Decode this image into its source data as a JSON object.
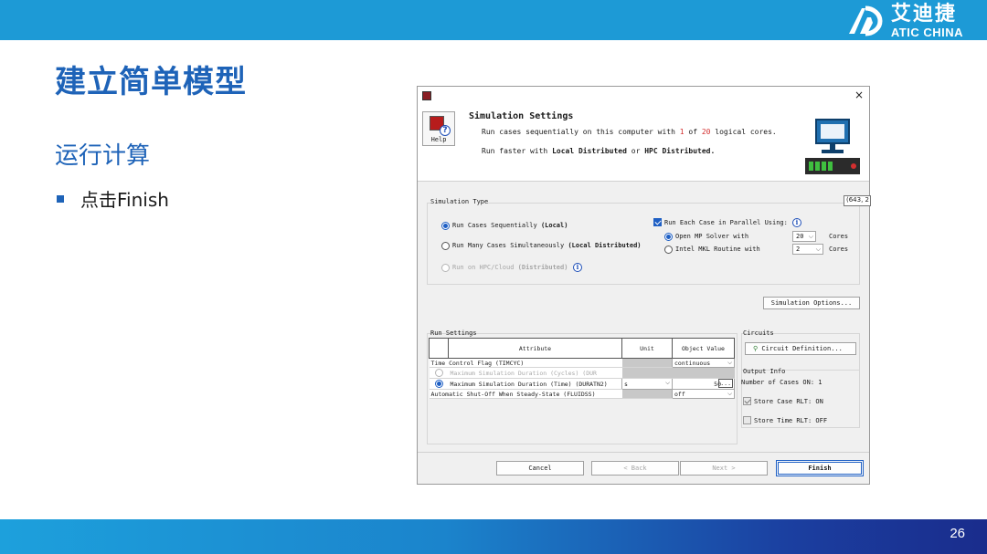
{
  "slide": {
    "title": "建立简单模型",
    "subtitle": "运行计算",
    "bullet": "点击Finish",
    "page_number": "26",
    "logo": {
      "cn": "艾迪捷",
      "en": "ATIC CHINA"
    },
    "colors": {
      "topbar": "#1d9ad6",
      "title": "#1e63b8",
      "accent": "#1e5fc4"
    }
  },
  "dialog": {
    "close_glyph": "×",
    "header": {
      "title": "Simulation Settings",
      "help_label": "Help",
      "line1_prefix": "Run cases sequentially on this computer with ",
      "line1_used": "1",
      "line1_of": " of ",
      "line1_total": "20",
      "line1_suffix": " logical cores.",
      "line2_prefix": "Run faster with ",
      "line2_local": "Local Distributed",
      "line2_or": " or ",
      "line2_hpc": "HPC Distributed."
    },
    "coord_readout": "(643, 2",
    "simulation_type": {
      "label": "Simulation Type",
      "opt_sequential": "Run Cases Sequentially ",
      "opt_sequential_bold": "(Local)",
      "opt_simultaneous": "Run Many Cases Simultaneously ",
      "opt_simultaneous_bold": "(Local Distributed)",
      "opt_hpc": "Run on HPC/Cloud ",
      "opt_hpc_bold": "(Distributed)",
      "parallel_label": "Run Each Case in Parallel Using:",
      "openmp_label": "Open MP Solver with",
      "openmp_cores": "20",
      "mkl_label": "Intel MKL Routine with",
      "mkl_cores": "2",
      "cores_label": "Cores",
      "options_button": "Simulation Options..."
    },
    "run_settings": {
      "label": "Run Settings",
      "columns": [
        "Attribute",
        "Unit",
        "Object Value"
      ],
      "rows": [
        {
          "attribute": "Time Control Flag (TIMCYC)",
          "unit": "",
          "value": "continuous"
        },
        {
          "attribute": "Maximum Simulation Duration (Cycles) (DUR",
          "unit": "",
          "value": ""
        },
        {
          "attribute": "Maximum Simulation Duration (Time) (DURATN2)",
          "unit": "s",
          "value": "50"
        },
        {
          "attribute": "Automatic Shut-Off When Steady-State (FLUIDSS)",
          "unit": "",
          "value": "off"
        }
      ],
      "ellipsis": "..."
    },
    "circuits": {
      "label": "Circuits",
      "button": "Circuit Definition...",
      "output_info_label": "Output Info",
      "cases_on": "Number of Cases ON: 1",
      "store_case": "Store Case RLT: ON",
      "store_time": "Store Time RLT: OFF"
    },
    "buttons": {
      "cancel": "Cancel",
      "back": "< Back",
      "next": "Next >",
      "finish": "Finish"
    }
  }
}
